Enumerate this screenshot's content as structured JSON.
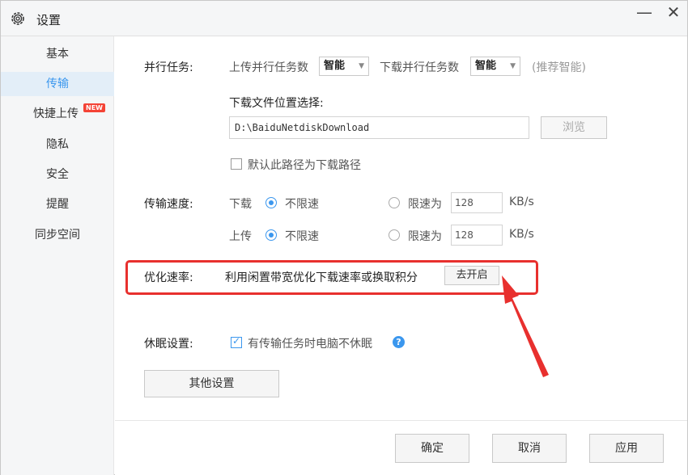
{
  "window": {
    "title": "设置",
    "minimize_glyph": "—",
    "close_glyph": "✕"
  },
  "sidebar": {
    "items": [
      {
        "label": "基本",
        "active": false
      },
      {
        "label": "传输",
        "active": true
      },
      {
        "label": "快捷上传",
        "badge": "NEW",
        "active": false
      },
      {
        "label": "隐私",
        "active": false
      },
      {
        "label": "安全",
        "active": false
      },
      {
        "label": "提醒",
        "active": false
      },
      {
        "label": "同步空间",
        "active": false
      }
    ]
  },
  "parallel": {
    "label": "并行任务:",
    "upload_label": "上传并行任务数",
    "upload_value": "智能",
    "download_label": "下载并行任务数",
    "download_value": "智能",
    "hint": "(推荐智能)"
  },
  "download_location": {
    "label": "下载文件位置选择:",
    "path": "D:\\BaiduNetdiskDownload",
    "browse_label": "浏览",
    "default_checkbox_label": "默认此路径为下载路径",
    "default_checked": false
  },
  "speed": {
    "label": "传输速度:",
    "rows": [
      {
        "direction": "下载",
        "unlimited_label": "不限速",
        "unlimited_checked": true,
        "limit_label": "限速为",
        "limit_value": "128",
        "unit": "KB/s"
      },
      {
        "direction": "上传",
        "unlimited_label": "不限速",
        "unlimited_checked": true,
        "limit_label": "限速为",
        "limit_value": "128",
        "unit": "KB/s"
      }
    ]
  },
  "optimize": {
    "label": "优化速率:",
    "description": "利用闲置带宽优化下载速率或换取积分",
    "button_label": "去开启"
  },
  "sleep": {
    "label": "休眠设置:",
    "checkbox_label": "有传输任务时电脑不休眠",
    "checked": true
  },
  "other_settings_label": "其他设置",
  "footer": {
    "ok_label": "确定",
    "cancel_label": "取消",
    "apply_label": "应用"
  },
  "colors": {
    "accent": "#3b97ee",
    "annotation": "#e8302e",
    "new_badge": "#f44336"
  }
}
